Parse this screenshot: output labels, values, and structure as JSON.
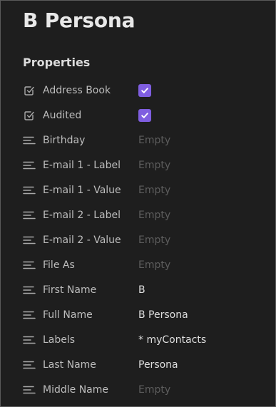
{
  "page": {
    "title": "B Persona",
    "section_heading": "Properties"
  },
  "properties": [
    {
      "name": "Address Book",
      "type": "checkbox",
      "checked": true,
      "icon": "checkbox-square-icon"
    },
    {
      "name": "Audited",
      "type": "checkbox",
      "checked": true,
      "icon": "checkbox-square-icon"
    },
    {
      "name": "Birthday",
      "type": "text",
      "value": "Empty",
      "is_empty": true,
      "icon": "text-lines-icon"
    },
    {
      "name": "E-mail 1 - Label",
      "type": "text",
      "value": "Empty",
      "is_empty": true,
      "icon": "text-lines-icon"
    },
    {
      "name": "E-mail 1 - Value",
      "type": "text",
      "value": "Empty",
      "is_empty": true,
      "icon": "text-lines-icon"
    },
    {
      "name": "E-mail 2 - Label",
      "type": "text",
      "value": "Empty",
      "is_empty": true,
      "icon": "text-lines-icon"
    },
    {
      "name": "E-mail 2 - Value",
      "type": "text",
      "value": "Empty",
      "is_empty": true,
      "icon": "text-lines-icon"
    },
    {
      "name": "File As",
      "type": "text",
      "value": "Empty",
      "is_empty": true,
      "icon": "text-lines-icon"
    },
    {
      "name": "First Name",
      "type": "text",
      "value": "B",
      "is_empty": false,
      "icon": "text-lines-icon"
    },
    {
      "name": "Full Name",
      "type": "text",
      "value": "B Persona",
      "is_empty": false,
      "icon": "text-lines-icon"
    },
    {
      "name": "Labels",
      "type": "text",
      "value": "* myContacts",
      "is_empty": false,
      "icon": "text-lines-icon"
    },
    {
      "name": "Last Name",
      "type": "text",
      "value": "Persona",
      "is_empty": false,
      "icon": "text-lines-icon"
    },
    {
      "name": "Middle Name",
      "type": "text",
      "value": "Empty",
      "is_empty": true,
      "icon": "text-lines-icon"
    }
  ],
  "colors": {
    "background": "#1e1e1e",
    "accent": "#7f5ee0",
    "text": "#dedede",
    "muted_label": "#bdbdbd",
    "empty_value": "#5d5d5d",
    "border": "#5a5a5a"
  }
}
